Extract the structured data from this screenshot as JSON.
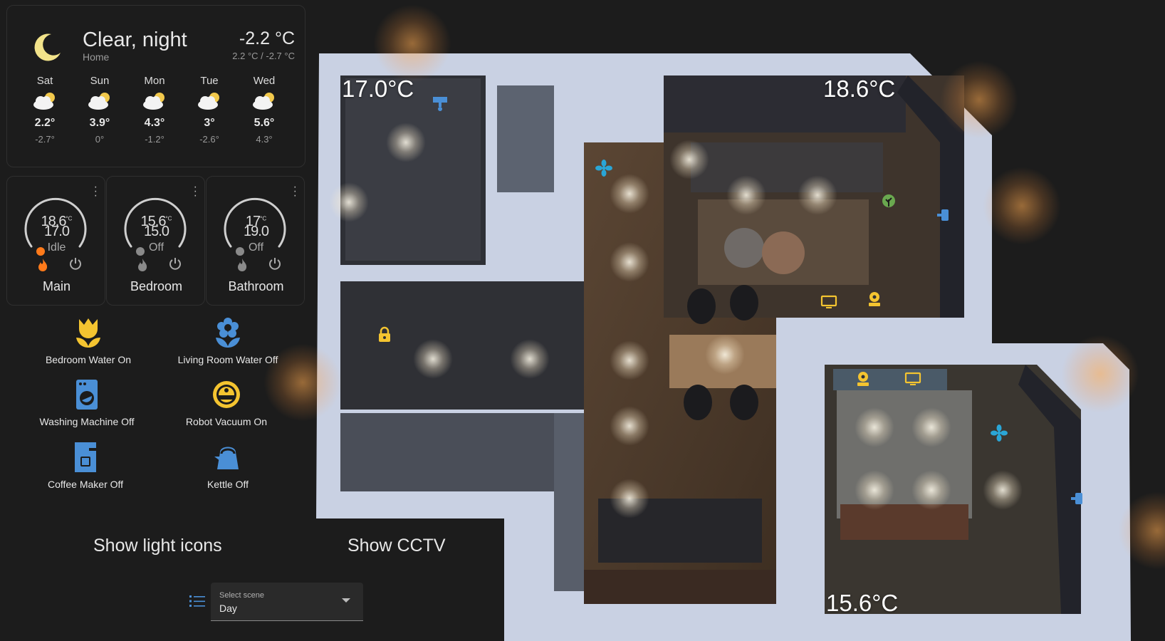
{
  "weather": {
    "condition": "Clear, night",
    "location": "Home",
    "temperature": "-2.2 °C",
    "range": "2.2 °C / -2.7 °C",
    "forecast": [
      {
        "day": "Sat",
        "high": "2.2°",
        "low": "-2.7°"
      },
      {
        "day": "Sun",
        "high": "3.9°",
        "low": "0°"
      },
      {
        "day": "Mon",
        "high": "4.3°",
        "low": "-1.2°"
      },
      {
        "day": "Tue",
        "high": "3°",
        "low": "-2.6°"
      },
      {
        "day": "Wed",
        "high": "5.6°",
        "low": "4.3°"
      }
    ]
  },
  "thermostats": [
    {
      "name": "Main",
      "current": "18.6",
      "target": "17.0",
      "status": "Idle",
      "unit": "°C"
    },
    {
      "name": "Bedroom",
      "current": "15.6",
      "target": "15.0",
      "status": "Off",
      "unit": "°C"
    },
    {
      "name": "Bathroom",
      "current": "17",
      "target": "19.0",
      "status": "Off",
      "unit": "°C"
    }
  ],
  "entity_buttons": [
    {
      "label": "Bedroom Water On",
      "icon": "tulip-icon",
      "color": "#f4c430"
    },
    {
      "label": "Living Room Water Off",
      "icon": "flower-icon",
      "color": "#4a8fd6"
    },
    {
      "label": "Washing Machine Off",
      "icon": "washing-machine-icon",
      "color": "#4a8fd6"
    },
    {
      "label": "Robot Vacuum On",
      "icon": "robot-vacuum-icon",
      "color": "#f4c430"
    },
    {
      "label": "Coffee Maker Off",
      "icon": "coffee-maker-icon",
      "color": "#4a8fd6"
    },
    {
      "label": "Kettle Off",
      "icon": "kettle-icon",
      "color": "#4a8fd6"
    }
  ],
  "actions": {
    "show_light_icons": "Show light icons",
    "show_cctv": "Show CCTV"
  },
  "scene": {
    "caption": "Select scene",
    "value": "Day"
  },
  "floorplan": {
    "room_temps": {
      "bathroom": "17.0°C",
      "living_room": "18.6°C",
      "bedroom": "15.6°C"
    }
  },
  "colors": {
    "accent_on": "#f4c430",
    "accent_off": "#4a8fd6",
    "heat": "#ff7a1a",
    "fan": "#2aa6d6"
  }
}
